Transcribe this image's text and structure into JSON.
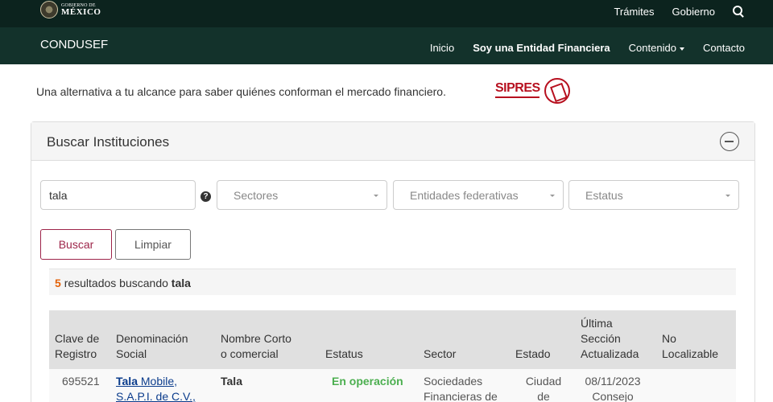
{
  "topbar": {
    "logo_line1": "GOBIERNO DE",
    "logo_line2": "MÉXICO",
    "links": [
      "Trámites",
      "Gobierno"
    ]
  },
  "mainnav": {
    "brand": "CONDUSEF",
    "links": [
      "Inicio",
      "Soy una Entidad Financiera",
      "Contenido",
      "Contacto"
    ]
  },
  "tagline": "Una alternativa a tu alcance para saber quiénes conforman el mercado financiero.",
  "sipres_logo": "SIPRES",
  "panel": {
    "title": "Buscar Instituciones",
    "search_value": "tala",
    "help_icon": "?",
    "selects": [
      "Sectores",
      "Entidades federativas",
      "Estatus"
    ],
    "buttons": {
      "search": "Buscar",
      "clear": "Limpiar"
    }
  },
  "results": {
    "count": "5",
    "text": "resultados buscando",
    "query": "tala"
  },
  "table": {
    "headers": {
      "clave1": "Clave de",
      "clave2": "Registro",
      "denom1": "Denominación",
      "denom2": "Social",
      "nombre1": "Nombre Corto",
      "nombre2": "o comercial",
      "estatus": "Estatus",
      "sector": "Sector",
      "estado": "Estado",
      "ultima1": "Última",
      "ultima2": "Sección",
      "ultima3": "Actualizada",
      "nolocal1": "No",
      "nolocal2": "Localizable"
    },
    "rows": [
      {
        "clave": "695521",
        "denom_bold": "Tala",
        "denom_rest": " Mobile,",
        "denom_line2": "S.A.P.I. de C.V.,",
        "nombre": "Tala",
        "estatus": "En operación",
        "sector1": "Sociedades",
        "sector2": "Financieras de",
        "estado1": "Ciudad",
        "estado2": "de",
        "fecha": "08/11/2023",
        "seccion": "Consejo"
      }
    ]
  },
  "colors": {
    "topbar": "#0c231e",
    "navbar": "#13322b",
    "accent": "#9d2449",
    "status_green": "#4caf50",
    "result_count": "#e36209"
  }
}
